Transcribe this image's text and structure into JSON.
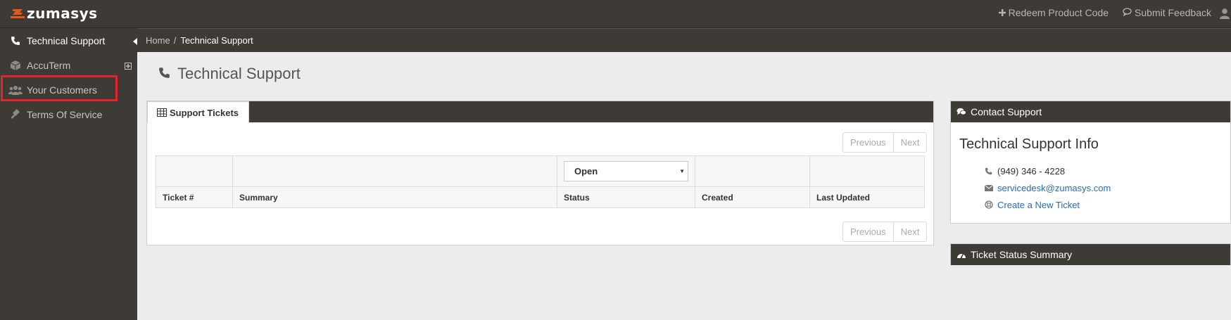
{
  "brand": {
    "name": "zumasys",
    "accent_color": "#e05a1c"
  },
  "topbar": {
    "redeem_label": "Redeem Product Code",
    "feedback_label": "Submit Feedback"
  },
  "sidebar": {
    "items": [
      {
        "label": "Technical Support",
        "icon": "phone-icon",
        "active": true
      },
      {
        "label": "AccuTerm",
        "icon": "cube-icon",
        "expandable": true
      },
      {
        "label": "Your Customers",
        "icon": "users-icon",
        "highlighted": true
      },
      {
        "label": "Terms Of Service",
        "icon": "gavel-icon"
      }
    ]
  },
  "breadcrumb": {
    "home": "Home",
    "separator": "/",
    "current": "Technical Support"
  },
  "page": {
    "title": "Technical Support"
  },
  "tickets": {
    "tab_label": "Support Tickets",
    "pager": {
      "previous": "Previous",
      "next": "Next"
    },
    "status_filter": "Open",
    "columns": [
      "Ticket #",
      "Summary",
      "Status",
      "Created",
      "Last Updated"
    ]
  },
  "contact": {
    "header": "Contact Support",
    "title": "Technical Support Info",
    "phone": "(949) 346 - 4228",
    "email": "servicedesk@zumasys.com",
    "create_ticket": "Create a New Ticket"
  },
  "status_summary": {
    "header": "Ticket Status Summary"
  }
}
